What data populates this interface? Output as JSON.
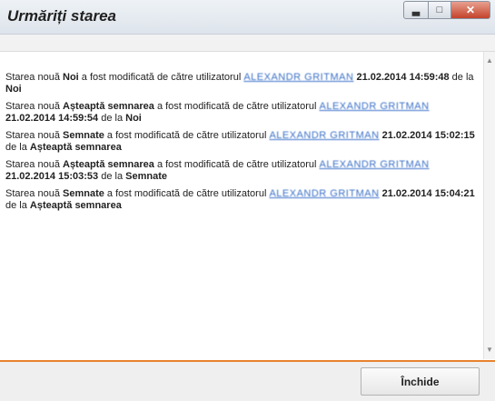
{
  "window": {
    "title": "Urmăriți starea",
    "controls": {
      "minimize_icon": "minimize-icon",
      "maximize_icon": "maximize-icon",
      "close_icon": "close-icon"
    }
  },
  "entries": [
    {
      "prefix": "Starea nouă ",
      "new_state": "Noi",
      "middle": " a fost modificată de către utilizatorul ",
      "user": "ALEXANDR GRITMAN",
      "datetime": " 21.02.2014 14:59:48",
      "from_text": " de la ",
      "old_state": "Noi"
    },
    {
      "prefix": "Starea nouă ",
      "new_state": "Așteaptă semnarea",
      "middle": " a fost modificată de către utilizatorul ",
      "user": "ALEXANDR GRITMAN",
      "datetime": " 21.02.2014 14:59:54",
      "from_text": " de la ",
      "old_state": "Noi"
    },
    {
      "prefix": "Starea nouă ",
      "new_state": "Semnate",
      "middle": " a fost modificată de către utilizatorul ",
      "user": "ALEXANDR GRITMAN",
      "datetime": " 21.02.2014 15:02:15",
      "from_text": " de la ",
      "old_state": "Așteaptă semnarea"
    },
    {
      "prefix": "Starea nouă ",
      "new_state": "Așteaptă semnarea",
      "middle": " a fost modificată de către utilizatorul ",
      "user": "ALEXANDR GRITMAN",
      "datetime": " 21.02.2014 15:03:53",
      "from_text": " de la ",
      "old_state": "Semnate"
    },
    {
      "prefix": "Starea nouă ",
      "new_state": "Semnate",
      "middle": " a fost modificată de către utilizatorul ",
      "user": "ALEXANDR GRITMAN",
      "datetime": " 21.02.2014 15:04:21",
      "from_text": " de la ",
      "old_state": "Așteaptă semnarea"
    }
  ],
  "footer": {
    "close_label": "Închide"
  },
  "colors": {
    "accent": "#e8822d",
    "link": "#3a70c8"
  }
}
